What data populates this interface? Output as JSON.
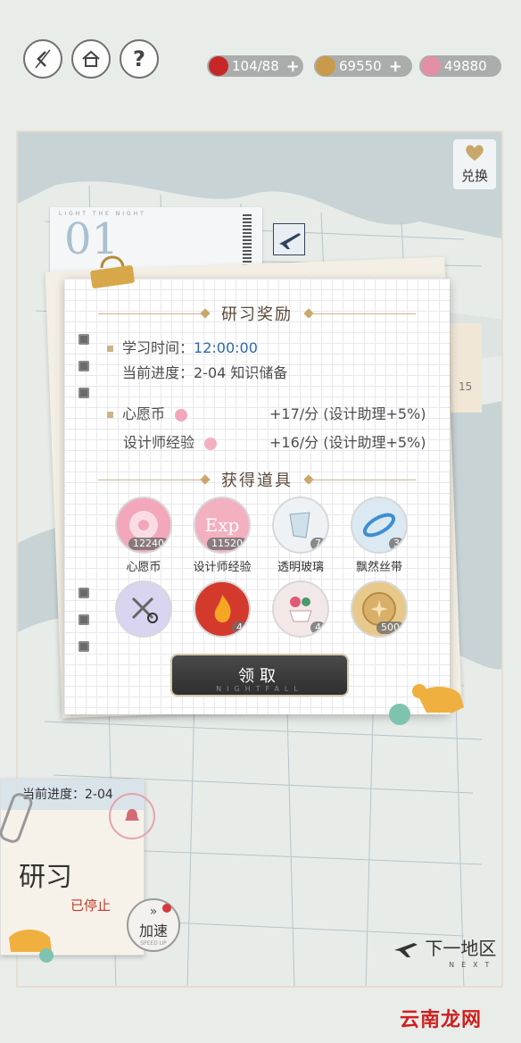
{
  "topbar": {
    "back_icon": "back-icon",
    "home_icon": "home-icon",
    "help_label": "?",
    "resources": [
      {
        "icon": "apple-icon",
        "value": "104/88",
        "color": "#c62828",
        "plus": "+"
      },
      {
        "icon": "coin-icon",
        "value": "69550",
        "color": "#c99a4a",
        "plus": "+"
      },
      {
        "icon": "gem-icon",
        "value": "49880",
        "color": "#e48fa6",
        "plus": ""
      }
    ]
  },
  "exchange": {
    "label": "兑换",
    "icon": "heart-icon"
  },
  "map_ticket": {
    "number": "01",
    "tiny": "LIGHT THE NIGHT"
  },
  "side_tag": {
    "text": "15"
  },
  "dialog": {
    "title": "研习奖励",
    "study_time_label": "学习时间：",
    "study_time_value": "12:00:00",
    "progress_label": "当前进度：",
    "progress_value": "2-04 知识储备",
    "wish_coin_label": "心愿币",
    "wish_coin_rate": "+17/分 (设计助理+5%)",
    "designer_exp_label": "设计师经验",
    "designer_exp_rate": "+16/分 (设计助理+5%)",
    "items_title": "获得道具",
    "items": [
      {
        "name": "心愿币",
        "qty": "12240",
        "icon": "wish-coin-icon",
        "bg": "#f2a7bb"
      },
      {
        "name": "设计师经验",
        "qty": "11520",
        "icon": "exp-icon",
        "bg": "#f3b0c0"
      },
      {
        "name": "透明玻璃",
        "qty": "7",
        "icon": "glass-icon",
        "bg": "#eef2f5"
      },
      {
        "name": "飘然丝带",
        "qty": "3",
        "icon": "ribbon-icon",
        "bg": "#dbe9f3"
      },
      {
        "name": "",
        "qty": "",
        "icon": "scissors-icon",
        "bg": "#d9d4f0"
      },
      {
        "name": "",
        "qty": "4",
        "icon": "flame-icon",
        "bg": "#d33a2c"
      },
      {
        "name": "",
        "qty": "4",
        "icon": "teacup-icon",
        "bg": "#f3e8e8"
      },
      {
        "name": "",
        "qty": "500",
        "icon": "gold-coin-icon",
        "bg": "#e8c98c"
      }
    ],
    "claim_label": "领取",
    "claim_sub": "NIGHTFALL"
  },
  "note": {
    "progress": "当前进度：2-04",
    "title": "研习",
    "status": "已停止"
  },
  "speed_up": {
    "label": "加速",
    "sub": "SPEED UP"
  },
  "next_region": {
    "label": "下一地区",
    "sub": "NEXT"
  },
  "watermark": "云南龙网"
}
